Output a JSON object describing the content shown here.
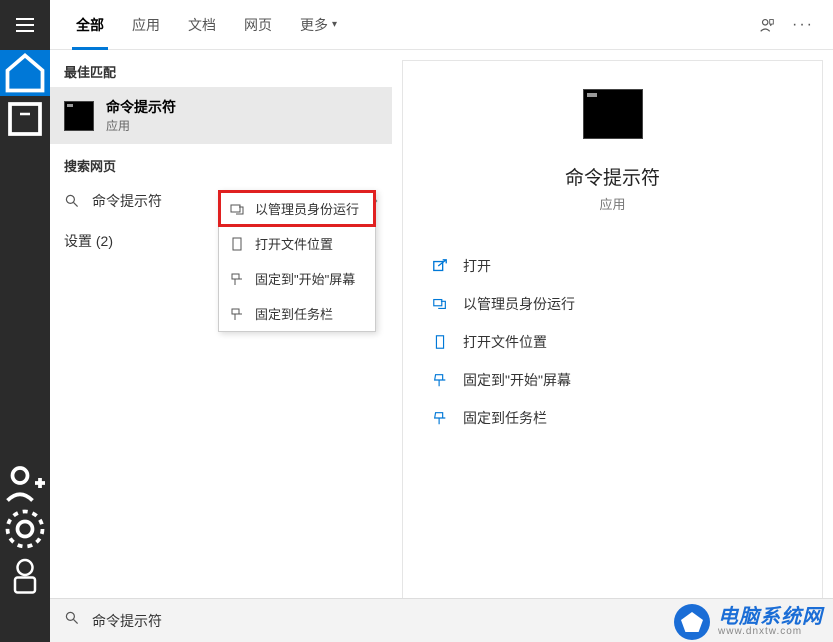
{
  "tabs": {
    "all": "全部",
    "apps": "应用",
    "docs": "文档",
    "web": "网页",
    "more": "更多"
  },
  "sections": {
    "best_match": "最佳匹配",
    "search_web": "搜索网页",
    "settings": "设置 (2)"
  },
  "best_match": {
    "title": "命令提示符",
    "subtitle": "应用"
  },
  "web_suggestion": "命令提示符",
  "context_menu": {
    "run_as_admin": "以管理员身份运行",
    "open_file_location": "打开文件位置",
    "pin_to_start": "固定到\"开始\"屏幕",
    "pin_to_taskbar": "固定到任务栏"
  },
  "detail": {
    "title": "命令提示符",
    "subtitle": "应用",
    "actions": {
      "open": "打开",
      "run_as_admin": "以管理员身份运行",
      "open_file_location": "打开文件位置",
      "pin_to_start": "固定到\"开始\"屏幕",
      "pin_to_taskbar": "固定到任务栏"
    }
  },
  "search_query": "命令提示符",
  "watermark": {
    "cn": "电脑系统网",
    "url": "www.dnxtw.com"
  }
}
